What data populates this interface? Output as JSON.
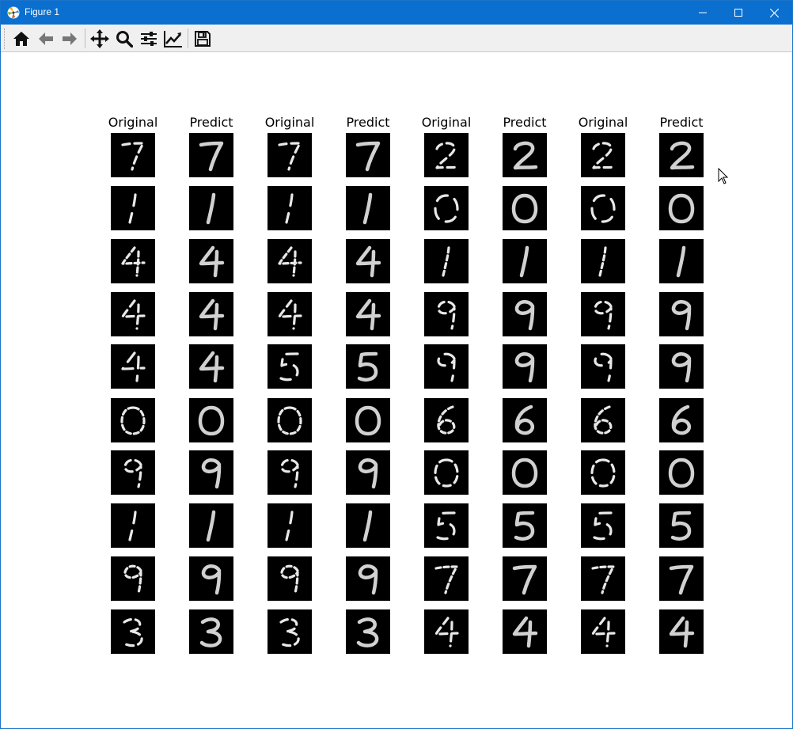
{
  "window": {
    "title": "Figure 1",
    "app_icon": "matplotlib-icon",
    "controls": [
      "minimize-icon",
      "maximize-icon",
      "close-icon"
    ]
  },
  "toolbar": {
    "buttons": [
      {
        "name": "home-button",
        "icon": "home-icon"
      },
      {
        "name": "back-button",
        "icon": "arrow-left-icon"
      },
      {
        "name": "forward-button",
        "icon": "arrow-right-icon"
      },
      {
        "name": "pan-button",
        "icon": "move-icon"
      },
      {
        "name": "zoom-button",
        "icon": "magnifier-icon"
      },
      {
        "name": "configure-subplots-button",
        "icon": "sliders-icon"
      },
      {
        "name": "edit-axes-button",
        "icon": "line-chart-icon"
      },
      {
        "name": "save-button",
        "icon": "floppy-disk-icon"
      }
    ]
  },
  "figure": {
    "column_titles": [
      "Original",
      "Predict",
      "Original",
      "Predict",
      "Original",
      "Predict",
      "Original",
      "Predict"
    ],
    "grid": [
      [
        "7",
        "7",
        "7",
        "7",
        "2",
        "2",
        "2",
        "2"
      ],
      [
        "1",
        "1",
        "1",
        "1",
        "0",
        "0",
        "0",
        "0"
      ],
      [
        "4",
        "4",
        "4",
        "4",
        "1",
        "1",
        "1",
        "1"
      ],
      [
        "4",
        "4",
        "4",
        "4",
        "9",
        "9",
        "9",
        "9"
      ],
      [
        "4",
        "4",
        "5",
        "5",
        "9",
        "9",
        "9",
        "9"
      ],
      [
        "0",
        "0",
        "0",
        "0",
        "6",
        "6",
        "6",
        "6"
      ],
      [
        "9",
        "9",
        "9",
        "9",
        "0",
        "0",
        "0",
        "0"
      ],
      [
        "1",
        "1",
        "1",
        "1",
        "5",
        "5",
        "5",
        "5"
      ],
      [
        "9",
        "9",
        "9",
        "9",
        "7",
        "7",
        "7",
        "7"
      ],
      [
        "3",
        "3",
        "3",
        "3",
        "4",
        "4",
        "4",
        "4"
      ]
    ]
  },
  "colors": {
    "titlebar": "#0a6fcf",
    "toolbar_bg": "#f0f0f0",
    "image_bg": "#000000",
    "digit_stroke": "#e8e8e8"
  }
}
